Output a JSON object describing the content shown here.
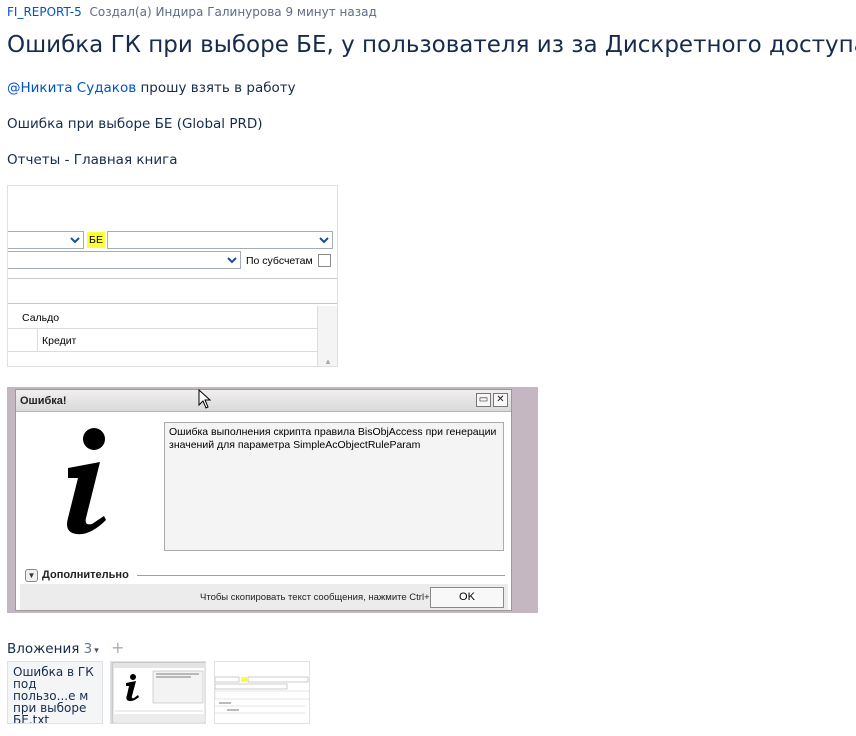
{
  "issue": {
    "key": "FI_REPORT-5",
    "created_meta": "Создал(а) Индира Галинурова 9 минут назад",
    "title": "Ошибка ГК при выборе БЕ, у пользователя из за Дискретного доступа"
  },
  "description": {
    "mention": "@Никита Судаков",
    "mention_rest": " прошу взять в работу",
    "line2": "Ошибка при выборе БЕ (Global PRD)",
    "line3": "Отчеты - Главная книга"
  },
  "form_screenshot": {
    "be_label": "БЕ",
    "subaccounts_label": "По субсчетам",
    "row_saldo": "Сальдо",
    "row_credit": "Кредит",
    "accent": "#ffff38"
  },
  "error_dialog": {
    "title": "Ошибка!",
    "message": "Ошибка выполнения скрипта правила BisObjAccess при генерации значений для параметра SimpleAcObjectRuleParam",
    "more_label": "Дополнительно",
    "copy_hint": "Чтобы скопировать текст сообщения, нажмите Ctrl+C",
    "ok_label": "OK",
    "restore_glyph": "▭",
    "close_glyph": "✕"
  },
  "attachments": {
    "label": "Вложения",
    "count": "3",
    "caret": "▾",
    "add": "+",
    "file_name": "Ошибка в ГК под пользо...е м при выборе БЕ.txt"
  },
  "icons": [
    "chevron-down-icon",
    "info-icon",
    "mouse-cursor-icon",
    "restore-icon",
    "close-icon",
    "add-icon"
  ]
}
